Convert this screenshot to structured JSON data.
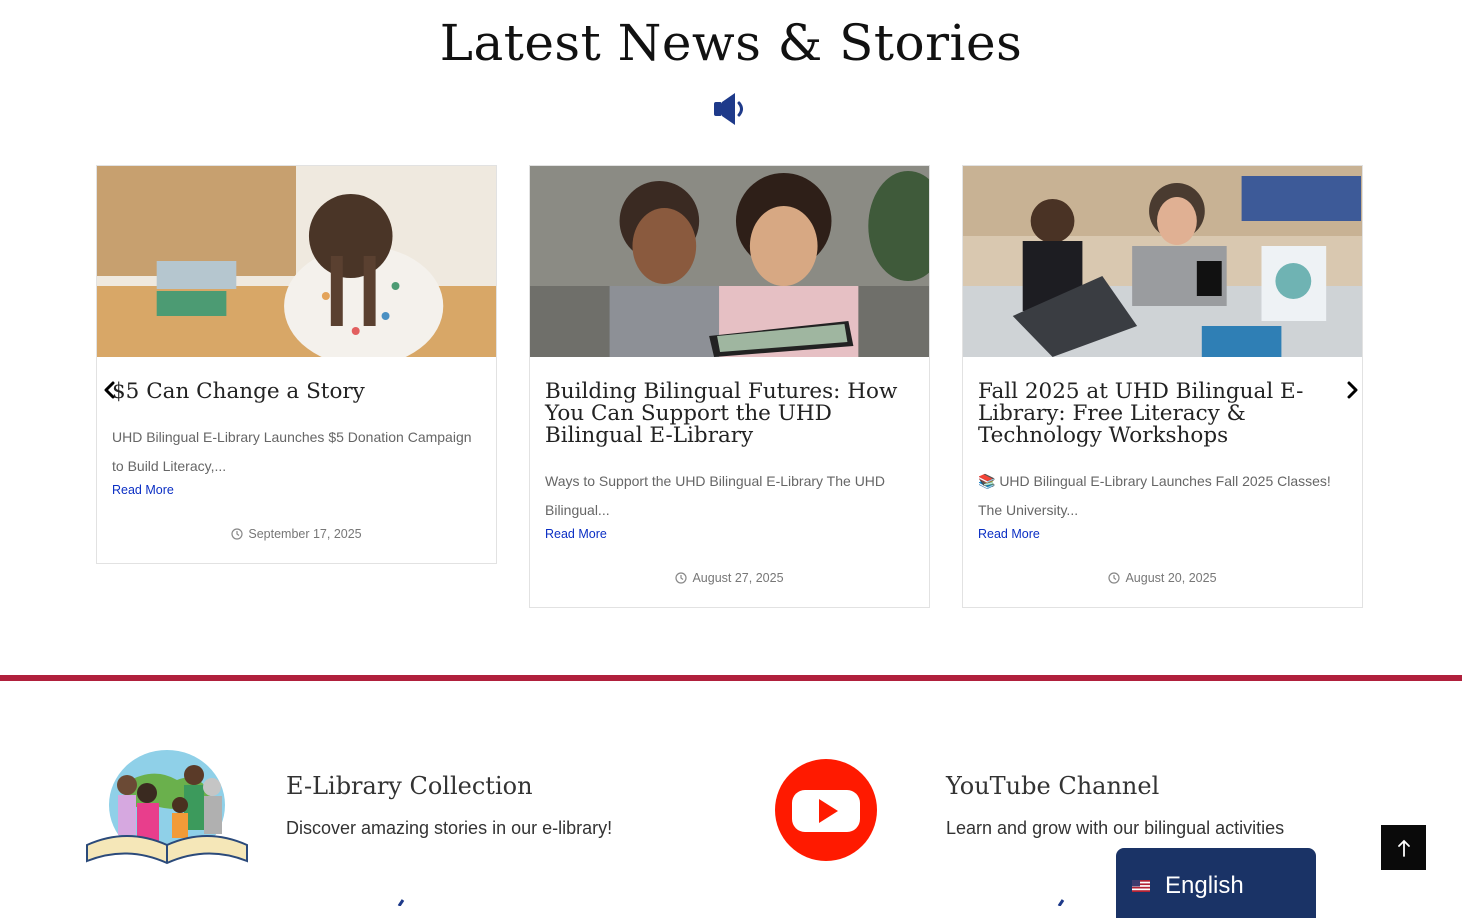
{
  "news": {
    "title": "Latest News & Stories",
    "icons": {
      "header": "megaphone-icon",
      "prev": "chevron-left-icon",
      "next": "chevron-right-icon",
      "date": "clock-icon"
    },
    "cards": [
      {
        "title": "$5 Can Change a Story",
        "excerpt": "UHD Bilingual E-Library Launches $5 Donation Campaign to Build Literacy,...",
        "read_more": "Read More",
        "date": "September 17, 2025"
      },
      {
        "title": "Building Bilingual Futures: How You Can Support the UHD Bilingual E-Library",
        "excerpt": "Ways to Support the UHD Bilingual E-Library The UHD Bilingual...",
        "read_more": "Read More",
        "date": "August 27, 2025"
      },
      {
        "title": "Fall 2025 at UHD Bilingual E-Library: Free Literacy & Technology Workshops",
        "excerpt": "📚 UHD Bilingual E-Library Launches Fall 2025 Classes! The University...",
        "read_more": "Read More",
        "date": "August 20, 2025"
      }
    ]
  },
  "features": [
    {
      "title": "E-Library Collection",
      "description": "Discover amazing stories in our e-library!",
      "icon": "family-reading-book-illustration"
    },
    {
      "title": "YouTube Channel",
      "description": "Learn and grow with our bilingual activities",
      "icon": "youtube-icon"
    }
  ],
  "language_switcher": {
    "label": "English",
    "flag": "us-flag-icon"
  },
  "back_to_top": {
    "icon": "arrow-up-icon"
  },
  "colors": {
    "accent_divider": "#b0203c",
    "link": "#0b2fc4",
    "language_bg": "#1a3366",
    "megaphone": "#1e3a8a",
    "youtube": "#ff1a00"
  }
}
